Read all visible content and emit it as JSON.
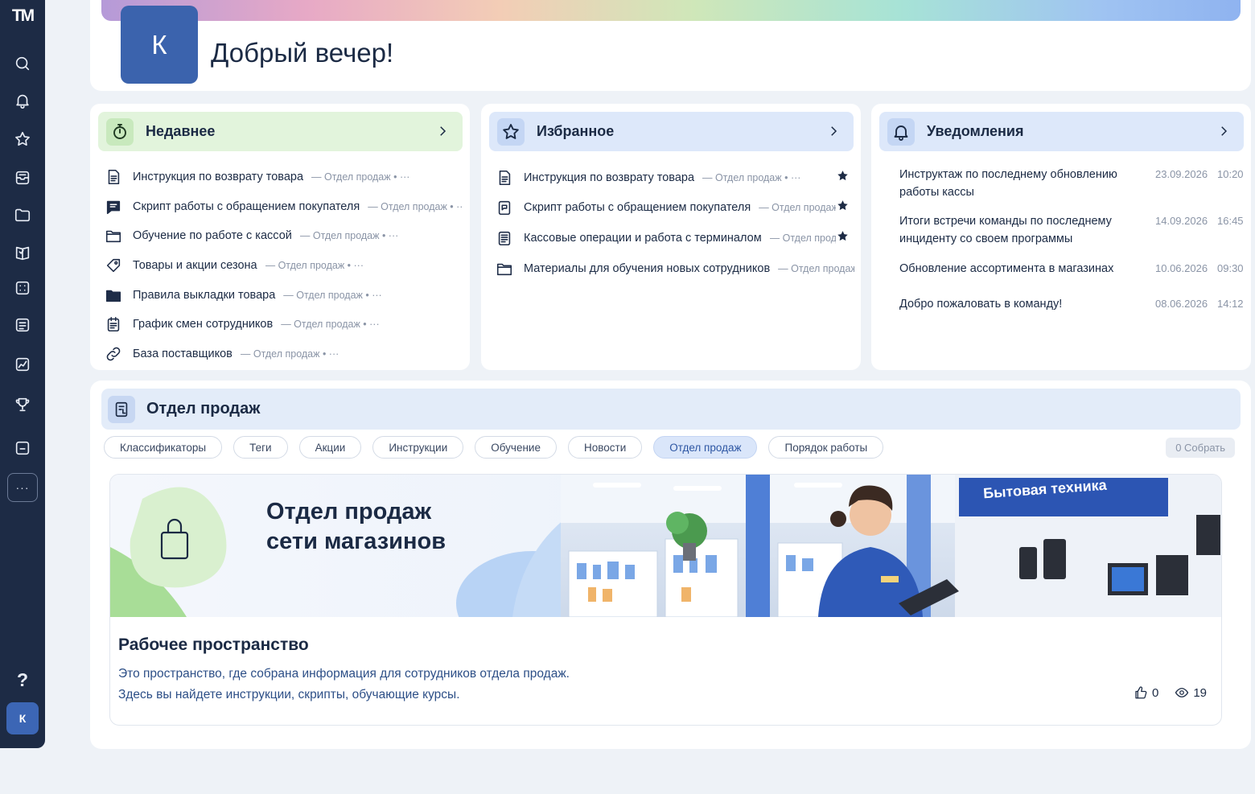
{
  "app": {
    "logo": "TM"
  },
  "sidebar": {
    "icons": [
      "search-icon",
      "bell-icon",
      "star-icon",
      "inbox-icon",
      "folder-icon",
      "book-icon",
      "grid-icon",
      "list-icon",
      "chart-icon",
      "trophy-icon",
      "archive-icon"
    ],
    "more": "···",
    "help": "?",
    "avatar": "К"
  },
  "greeting": {
    "avatar_letter": "К",
    "text": "Добрый вечер!"
  },
  "recent": {
    "title": "Недавнее",
    "accent": "#e2f4dc",
    "items": [
      {
        "icon": "document-icon",
        "title": "Инструкция по возврату товара",
        "meta": "— Отдел продаж • ···"
      },
      {
        "icon": "chat-icon",
        "title": "Скрипт работы с обращением покупателя",
        "meta": "— Отдел продаж • ···"
      },
      {
        "icon": "folder-icon",
        "title": "Обучение по работе с кассой",
        "meta": "— Отдел продаж • ···"
      },
      {
        "icon": "tag-icon",
        "title": "Товары и акции сезона",
        "meta": "— Отдел продаж • ···"
      },
      {
        "icon": "folder-icon",
        "title": "Правила выкладки товара",
        "meta": "— Отдел продаж • ···"
      },
      {
        "icon": "calendar-icon",
        "title": "График смен сотрудников",
        "meta": "— Отдел продаж • ···"
      },
      {
        "icon": "link-icon",
        "title": "База поставщиков",
        "meta": "— Отдел продаж • ···"
      }
    ]
  },
  "favorites": {
    "title": "Избранное",
    "accent": "#dde8fa",
    "items": [
      {
        "icon": "document-icon",
        "title": "Инструкция по возврату товара",
        "meta": "— Отдел продаж • ···",
        "starred": true
      },
      {
        "icon": "chat-doc-icon",
        "title": "Скрипт работы с обращением покупателя",
        "meta": "— Отдел продаж ·",
        "starred": true
      },
      {
        "icon": "doc-filled-icon",
        "title": "Кассовые операции и работа с терминалом",
        "meta": "— Отдел продаж ···",
        "starred": true
      },
      {
        "icon": "folder-icon",
        "title": "Материалы для обучения новых сотрудников",
        "meta": "— Отдел продаж • ···",
        "starred": false
      }
    ]
  },
  "notifications": {
    "title": "Уведомления",
    "accent": "#dde8fa",
    "items": [
      {
        "icon": "upload-doc-icon",
        "title": "Инструктаж по последнему обновлению работы кассы",
        "date": "23.09.2026",
        "time": "10:20"
      },
      {
        "icon": "chat-doc-icon",
        "title": "Итоги встречи команды по последнему инциденту со своем программы",
        "date": "14.09.2026",
        "time": "16:45"
      },
      {
        "icon": "pink-doc-icon",
        "title": "Обновление ассортимента в магазинах",
        "date": "10.06.2026",
        "time": "09:30"
      },
      {
        "icon": "user-icon",
        "title": "Добро пожаловать в команду!",
        "date": "08.06.2026",
        "time": "14:12"
      }
    ]
  },
  "section": {
    "title": "Отдел продаж",
    "chips": [
      {
        "label": "Классификаторы",
        "active": false
      },
      {
        "label": "Теги",
        "active": false
      },
      {
        "label": "Акции",
        "active": false
      },
      {
        "label": "Инструкции",
        "active": false
      },
      {
        "label": "Обучение",
        "active": false
      },
      {
        "label": "Новости",
        "active": false
      },
      {
        "label": "Отдел продаж",
        "active": true
      },
      {
        "label": "Порядок работы",
        "active": false
      }
    ],
    "collapse": "0 Собрать",
    "banner": {
      "title_line1": "Отдел продаж",
      "title_line2": "сети магазинов",
      "store_sign": "Бытовая техника"
    },
    "workspace_title": "Рабочее пространство",
    "desc_line1": "Это пространство, где собрана информация для сотрудников отдела продаж.",
    "desc_line2": "Здесь вы найдете инструкции, скрипты, обучающие курсы.",
    "likes": "0",
    "views": "19"
  }
}
